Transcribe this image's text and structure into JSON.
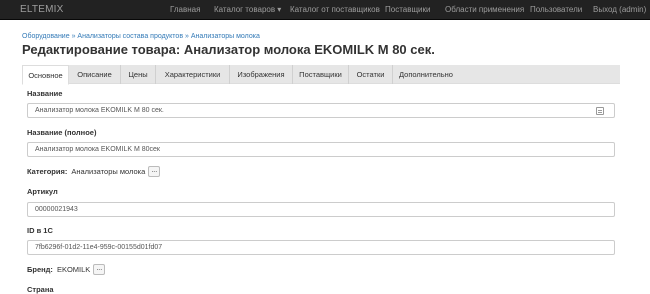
{
  "navbar": {
    "brand": "ELTEMIX",
    "items": [
      {
        "label": "Главная"
      },
      {
        "label": "Каталог товаров ▾"
      },
      {
        "label": "Каталог от поставщиков"
      },
      {
        "label": "Поставщики"
      },
      {
        "label": "Области применения"
      },
      {
        "label": "Пользователи"
      },
      {
        "label": "Выход (admin)"
      }
    ]
  },
  "breadcrumb": {
    "items": [
      "Оборудование",
      "Анализаторы состава продуктов",
      "Анализаторы молока"
    ],
    "separator": "»"
  },
  "page_title": "Редактирование товара: Анализатор молока EKOMILK M 80 сек.",
  "tabs": [
    {
      "label": "Основное",
      "active": true
    },
    {
      "label": "Описание"
    },
    {
      "label": "Цены"
    },
    {
      "label": "Характеристики"
    },
    {
      "label": "Изображения"
    },
    {
      "label": "Поставщики"
    },
    {
      "label": "Остатки"
    },
    {
      "label": "Дополнительно"
    }
  ],
  "form": {
    "name_label": "Название",
    "name_value": "Анализатор молока EKOMILK M 80 сек.",
    "fullname_label": "Название (полное)",
    "fullname_value": "Анализатор молока EKOMILK M 80сек",
    "category_label": "Категория:",
    "category_value": "Анализаторы молока",
    "article_label": "Артикул",
    "article_value": "00000021943",
    "id1c_label": "ID в 1С",
    "id1c_value": "7fb6296f-01d2-11e4-959c-00155d01fd07",
    "brand_label": "Бренд:",
    "brand_value": "EKOMILK",
    "country_label": "Страна",
    "dots_label": "..."
  }
}
